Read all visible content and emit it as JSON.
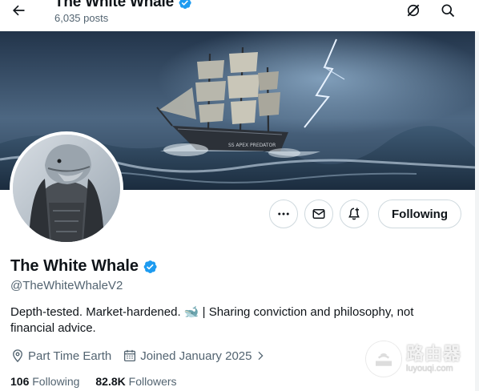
{
  "header": {
    "title": "The White Whale",
    "posts_count": "6,035 posts"
  },
  "icons": {
    "back": "arrow-left-icon",
    "grok": "grok-icon",
    "search": "search-icon",
    "more": "more-icon",
    "message": "mail-icon",
    "notify": "bell-plus-icon",
    "verified": "verified-badge-icon",
    "location": "location-pin-icon",
    "calendar": "calendar-icon"
  },
  "colors": {
    "verified": "#1d9bf0",
    "text_secondary": "#536471"
  },
  "actions": {
    "following_label": "Following"
  },
  "profile": {
    "name": "The White Whale",
    "handle": "@TheWhiteWhaleV2",
    "bio_line1": "Depth-tested. Market-hardened. 🐋 | Sharing conviction and philosophy, not",
    "bio_line2": "financial advice.",
    "location": "Part Time Earth",
    "joined": "Joined January 2025",
    "following_count": "106",
    "following_label": "Following",
    "followers_count": "82.8K",
    "followers_label": "Followers"
  },
  "watermark": {
    "name": "路由器",
    "url": "luyouqi.com"
  }
}
